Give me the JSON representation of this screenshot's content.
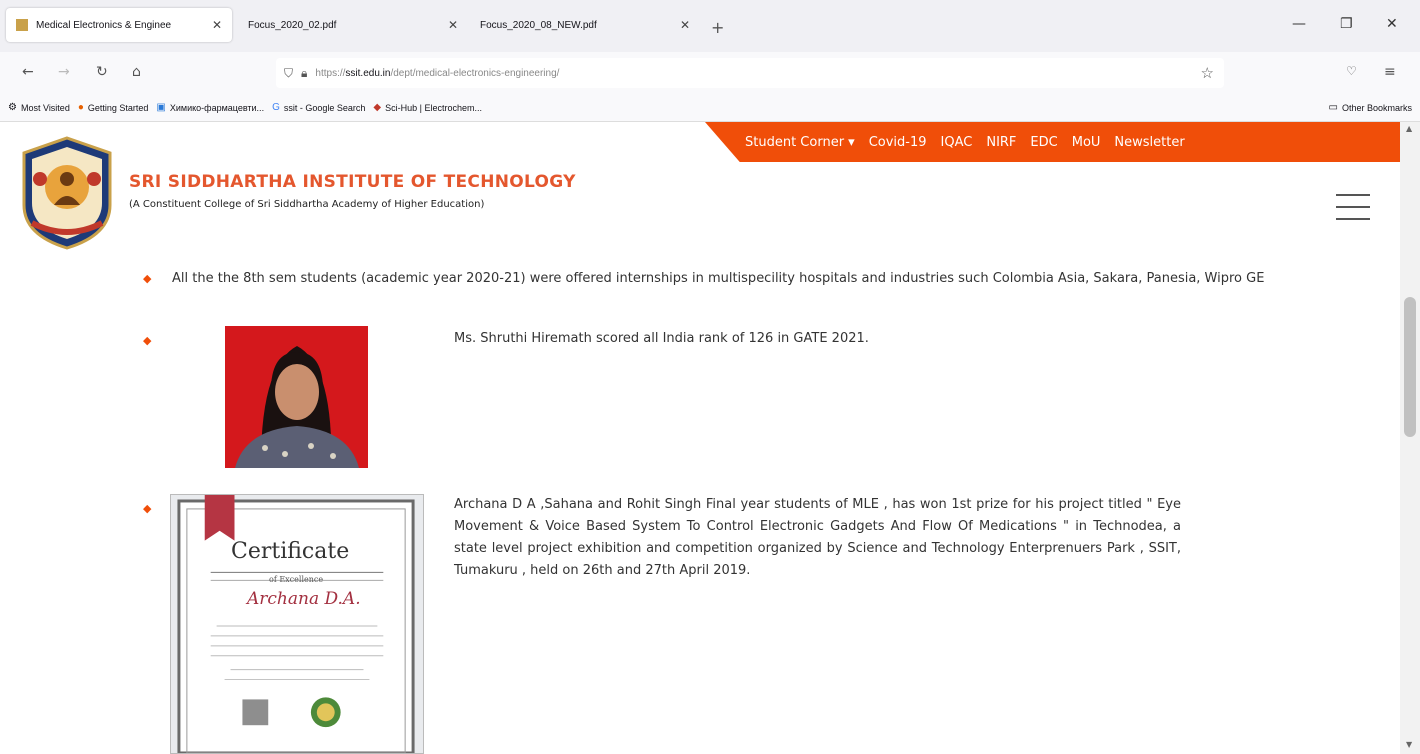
{
  "browser": {
    "tabs": [
      {
        "title": "Medical Electronics & Enginee",
        "active": true
      },
      {
        "title": "Focus_2020_02.pdf",
        "active": false
      },
      {
        "title": "Focus_2020_08_NEW.pdf",
        "active": false
      }
    ],
    "url": {
      "prefix": "https://",
      "host": "ssit.edu.in",
      "path": "/dept/medical-electronics-engineering/"
    },
    "bookmarks": [
      {
        "label": "Most Visited",
        "icon": "gear-icon"
      },
      {
        "label": "Getting Started",
        "icon": "firefox-icon"
      },
      {
        "label": "Химико-фармацевти...",
        "icon": "bookmark-icon"
      },
      {
        "label": "ssit - Google Search",
        "icon": "google-icon"
      },
      {
        "label": "Sci-Hub | Electrochem...",
        "icon": "scihub-icon"
      }
    ],
    "other_bookmarks": "Other Bookmarks"
  },
  "site": {
    "topnav": [
      "Student Corner ▾",
      "Covid-19",
      "IQAC",
      "NIRF",
      "EDC",
      "MoU",
      "Newsletter"
    ],
    "institution_name": "SRI SIDDHARTHA INSTITUTE OF TECHNOLOGY",
    "institution_sub": "(A Constituent College of Sri Siddhartha Academy of Higher Education)",
    "accent_color": "#f04e09"
  },
  "content": {
    "item1": "All the the 8th sem students (academic year 2020-21) were offered internships in multispecility hospitals and industries such Colombia Asia, Sakara, Panesia, Wipro GE",
    "item2": "Ms. Shruthi Hiremath scored all India rank of 126 in GATE 2021.",
    "item3": "Archana D A ,Sahana and Rohit Singh Final year students of MLE , has won 1st prize for his project titled \" Eye Movement & Voice Based System To Control Electronic Gadgets And Flow Of Medications \" in Technodea, a state level project exhibition and competition organized by Science and Technology Enterprenuers Park , SSIT, Tumakuru , held on 26th and 27th April 2019.",
    "certificate": {
      "title": "Certificate",
      "subtitle": "of Excellence",
      "name": "Archana D.A."
    }
  }
}
